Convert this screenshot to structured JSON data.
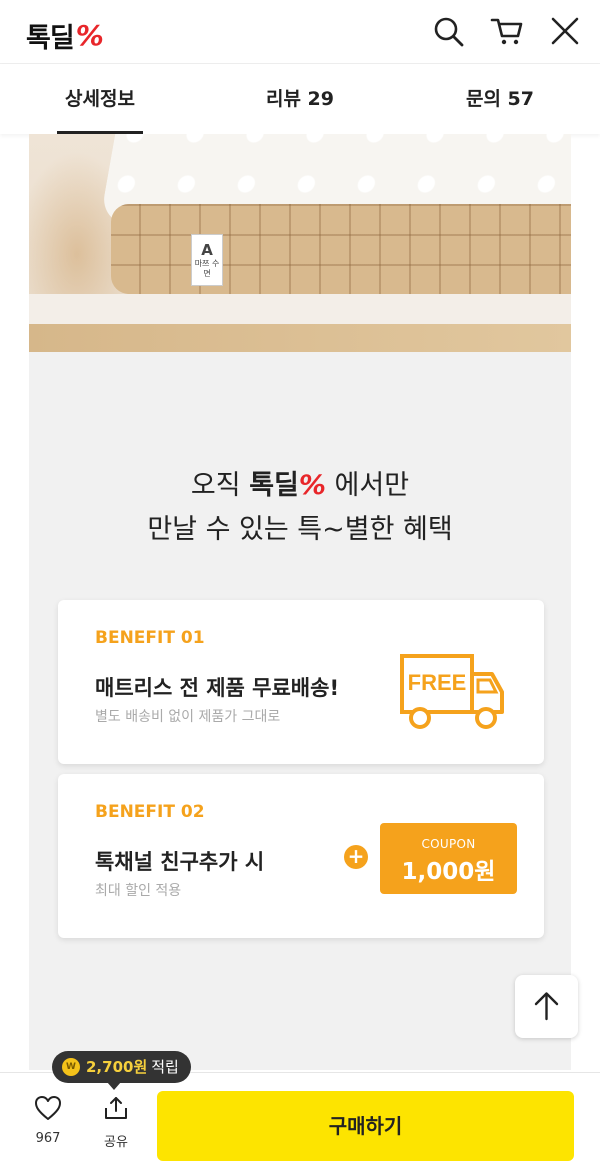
{
  "header": {
    "logo_text": "톡딜",
    "logo_mark": "%"
  },
  "tabs": [
    {
      "label": "상세정보"
    },
    {
      "label": "리뷰 29"
    },
    {
      "label": "문의 57"
    }
  ],
  "detail": {
    "photo": {
      "tag_letter": "A",
      "tag_text": "마쯔 수면"
    },
    "headline_pre": "오직",
    "headline_brand": "톡딜",
    "headline_brand_mark": "%",
    "headline_post": "에서만",
    "headline_line2": "만날 수 있는 특~별한 혜택"
  },
  "benefits": [
    {
      "no": "BENEFIT 01",
      "title": "매트리스 전 제품 무료배송!",
      "sub": "별도 배송비 없이 제품가 그대로",
      "badge": "FREE"
    },
    {
      "no": "BENEFIT 02",
      "title": "톡채널 친구추가 시",
      "sub": "최대 할인 적용",
      "coupon_label": "COUPON",
      "coupon_amount": "1,000원"
    }
  ],
  "bottom": {
    "like_count": "967",
    "share_label": "공유",
    "buy_label": "구매하기",
    "point_coin": "W",
    "point_amount": "2,700원",
    "point_suffix": "적립"
  },
  "colors": {
    "accent_orange": "#f5a21c",
    "buy_yellow": "#fde400",
    "logo_red": "#e8262a"
  }
}
